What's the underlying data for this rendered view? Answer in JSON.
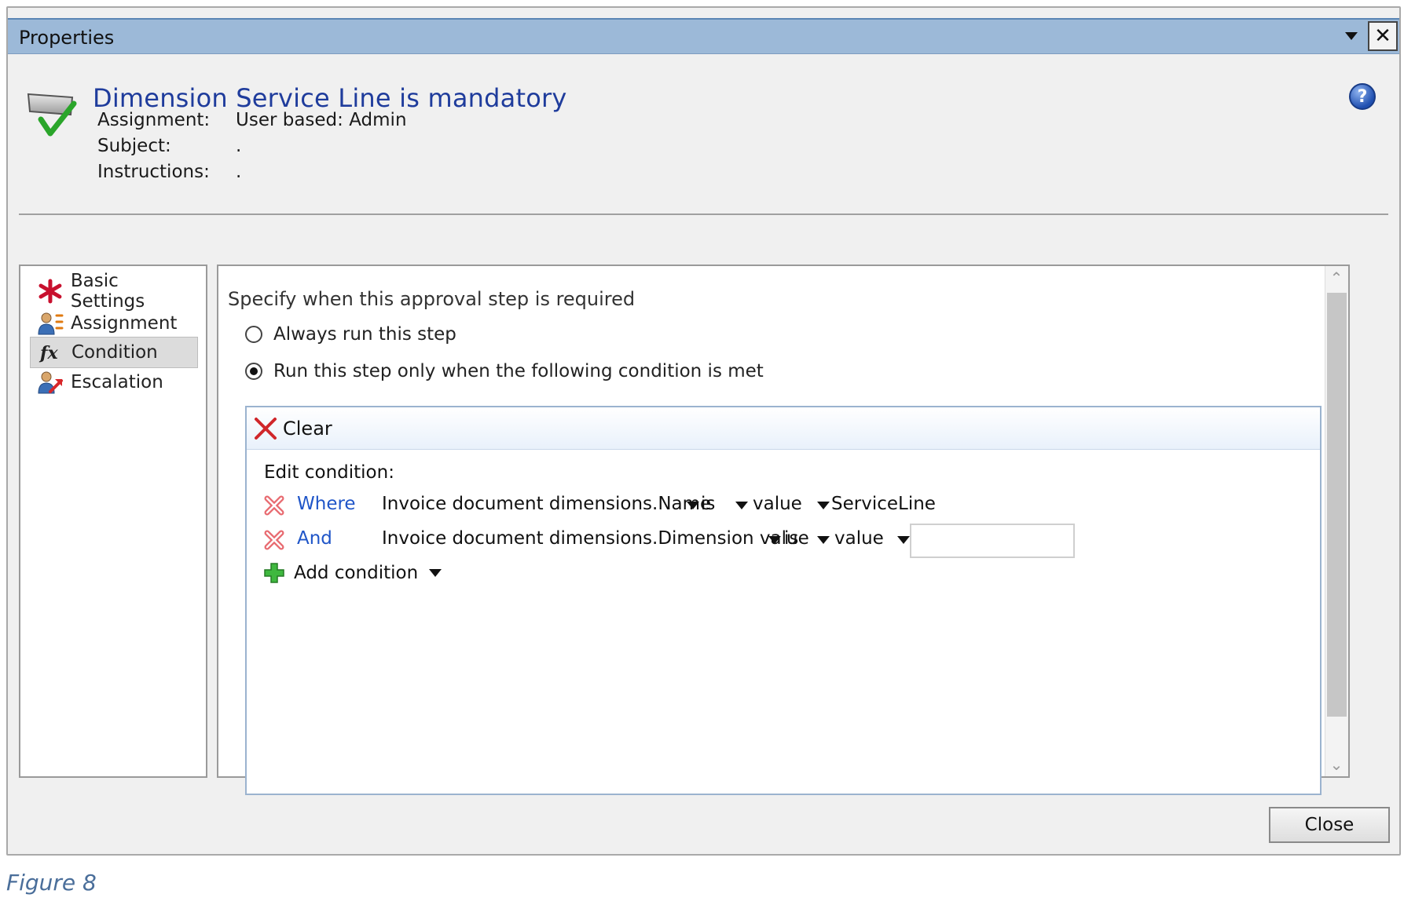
{
  "window": {
    "title": "Properties",
    "close_glyph": "✕"
  },
  "header": {
    "title": "Dimension Service Line is mandatory",
    "icon": "approval-check-icon",
    "help_glyph": "?",
    "fields": [
      {
        "label": "Assignment:",
        "value": "User based: Admin"
      },
      {
        "label": "Subject:",
        "value": "."
      },
      {
        "label": "Instructions:",
        "value": "."
      }
    ]
  },
  "nav": {
    "items": [
      {
        "label": "Basic Settings",
        "icon": "required-asterisk-icon",
        "selected": false
      },
      {
        "label": "Assignment",
        "icon": "user-assignment-icon",
        "selected": false
      },
      {
        "label": "Condition",
        "icon": "function-fx-icon",
        "selected": true
      },
      {
        "label": "Escalation",
        "icon": "user-escalation-icon",
        "selected": false
      }
    ]
  },
  "condition_panel": {
    "heading": "Specify when this approval step is required",
    "options": [
      {
        "label": "Always run this step",
        "checked": false
      },
      {
        "label": "Run this step only when the following condition is met",
        "checked": true
      }
    ],
    "toolbar": {
      "clear_label": "Clear"
    },
    "edit_label": "Edit condition:",
    "rows": [
      {
        "conjunction": "Where",
        "field": "Invoice document dimensions.Name",
        "operator": "is",
        "value_type": "value",
        "value": "ServiceLine"
      },
      {
        "conjunction": "And",
        "field": "Invoice document dimensions.Dimension value",
        "operator": "is",
        "value_type": "value",
        "value": ""
      }
    ],
    "add_condition_label": "Add condition"
  },
  "footer": {
    "close_label": "Close"
  },
  "caption": "Figure 8",
  "colors": {
    "titlebar": "#9cb9d8",
    "header_title": "#1f3c9c",
    "conjunction": "#1f55c8",
    "caption": "#4a6e9a"
  }
}
